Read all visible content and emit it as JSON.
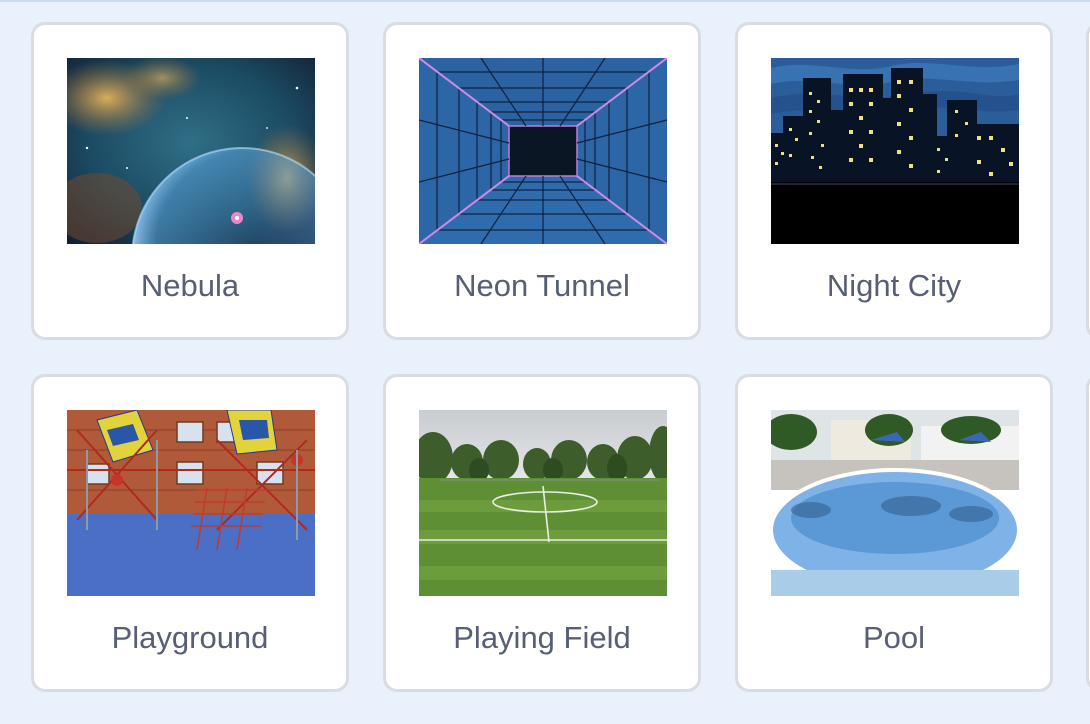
{
  "library": {
    "items": [
      {
        "label": "Nebula",
        "thumbnail": "nebula-image"
      },
      {
        "label": "Neon Tunnel",
        "thumbnail": "neon-tunnel-image"
      },
      {
        "label": "Night City",
        "thumbnail": "night-city-image"
      },
      {
        "label": "Playground",
        "thumbnail": "playground-image"
      },
      {
        "label": "Playing Field",
        "thumbnail": "playing-field-image"
      },
      {
        "label": "Pool",
        "thumbnail": "pool-image"
      }
    ]
  },
  "colors": {
    "page_background": "#e9f1fc",
    "card_background": "#ffffff",
    "card_border": "#d9dde3",
    "label_text": "#575e75"
  }
}
